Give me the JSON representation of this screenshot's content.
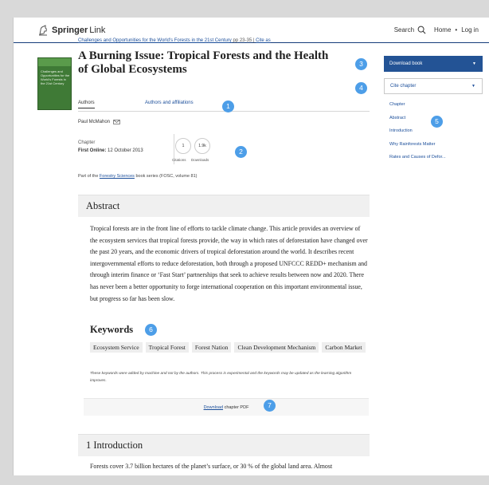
{
  "header": {
    "brand_bold": "Springer",
    "brand_light": "Link",
    "search_label": "Search",
    "home_label": "Home",
    "dot": "•",
    "login_label": "Log in"
  },
  "cover": {
    "text": "Challenges and Opportunities for the World's Forests in the 21st Century"
  },
  "breadcrumb": {
    "book_link": "Challenges and Opportunities for the World's Forests in the 21st Century",
    "pages": "pp 23-35",
    "separator": "|",
    "cite_link": "Cite as"
  },
  "chapter": {
    "title": "A Burning Issue: Tropical Forests and the Health of Global Ecosystems",
    "tab_authors": "Authors",
    "tab_affiliations": "Authors and affiliations",
    "author_name": "Paul McMahon",
    "type_label": "Chapter",
    "first_online_label": "First Online:",
    "first_online_date": "12 October 2013",
    "citations_value": "1",
    "citations_label": "Citations",
    "downloads_value": "1.9k",
    "downloads_label": "Downloads",
    "partof_prefix": "Part of the",
    "partof_link": "Forestry Sciences",
    "partof_suffix": "book series (FOSC, volume 81)"
  },
  "abstract": {
    "heading": "Abstract",
    "text": "Tropical forests are in the front line of efforts to tackle climate change. This article provides an overview of the ecosystem services that tropical forests provide, the way in which rates of deforestation have changed over the past 20 years, and the economic drivers of tropical deforestation around the world. It describes recent intergovernmental efforts to reduce deforestation, both through a proposed UNFCCC REDD+ mechanism and through interim finance or ‘Fast Start’ partnerships that seek to achieve results between now and 2020. There has never been a better opportunity to forge international cooperation on this important environmental issue, but progress so far has been slow."
  },
  "keywords": {
    "heading": "Keywords",
    "items": [
      "Ecosystem Service",
      "Tropical Forest",
      "Forest Nation",
      "Clean Development Mechanism",
      "Carbon Market"
    ],
    "note": "These keywords were added by machine and not by the authors. This process is experimental and the keywords may be updated as the learning algorithm improves."
  },
  "download_bar": {
    "link": "Download",
    "suffix": "chapter PDF"
  },
  "introduction": {
    "heading": "1 Introduction",
    "text": "Forests cover 3.7 billion hectares of the planet’s surface, or 30 % of the global land area. Almost"
  },
  "sidebar": {
    "download_book": "Download book",
    "cite_chapter": "Cite chapter",
    "caret": "▼",
    "toc": [
      "Chapter",
      "Abstract",
      "Introduction",
      "Why Rainforests Matter",
      "Rates and Causes of Defor..."
    ]
  },
  "callouts": [
    "1",
    "2",
    "3",
    "4",
    "5",
    "6",
    "7"
  ],
  "colors": {
    "accent": "#235395",
    "link": "#1b4e9a",
    "callout": "#4d9ee8"
  }
}
